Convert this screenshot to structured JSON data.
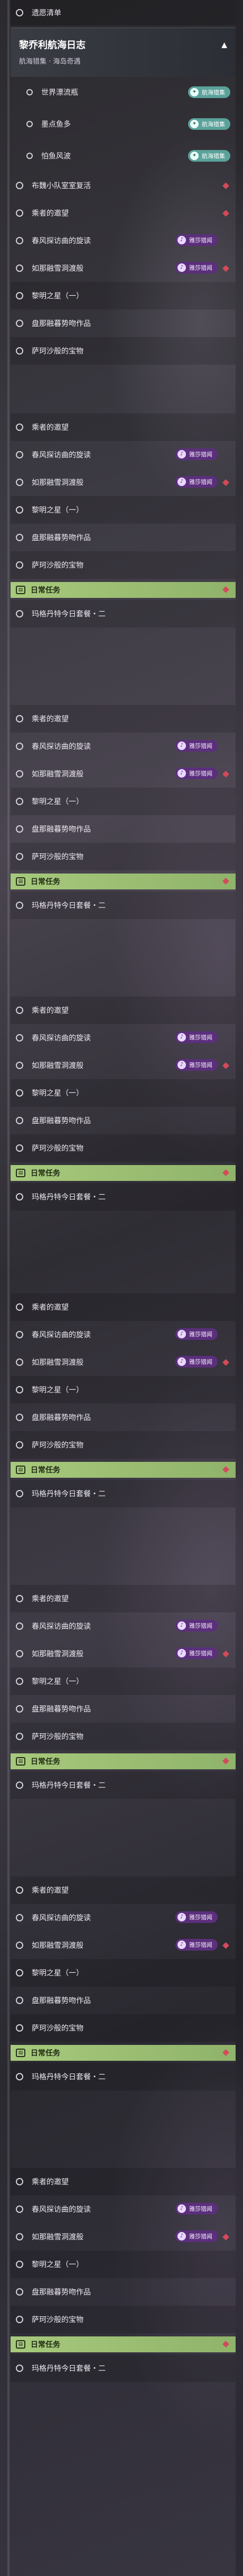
{
  "header": {
    "title": "黎乔利航海日志",
    "subtitle": "航海猎集 · 海岛奇遇",
    "chevron_icon": "chevron-up-icon"
  },
  "top_item": {
    "label": "遗愿清单"
  },
  "header_items": [
    {
      "label": "世界漂流瓶",
      "badge": "航海猎集"
    },
    {
      "label": "墨点鱼多",
      "badge": "航海猎集"
    },
    {
      "label": "怕鱼风波",
      "badge": "航海猎集"
    }
  ],
  "badges": {
    "voyage": "航海猎集",
    "purple": "雅莎猎闻"
  },
  "daily_title": "日常任务",
  "labels": {
    "a": "布魏小队室室复活",
    "b": "乘者的邀望",
    "c": "春风探访曲的旋读",
    "d": "如那融雪洞渡般",
    "e": "黎明之星（一）",
    "f": "盘那融暮势吻作品",
    "g": "萨珂沙般的宝物",
    "h": "玛格丹特今日套餐・二"
  },
  "colors": {
    "accent_purple": "#5b2f7c",
    "accent_green": "#8fb36a",
    "diamond": "#d44a5a",
    "teal": "#5aa29a"
  }
}
